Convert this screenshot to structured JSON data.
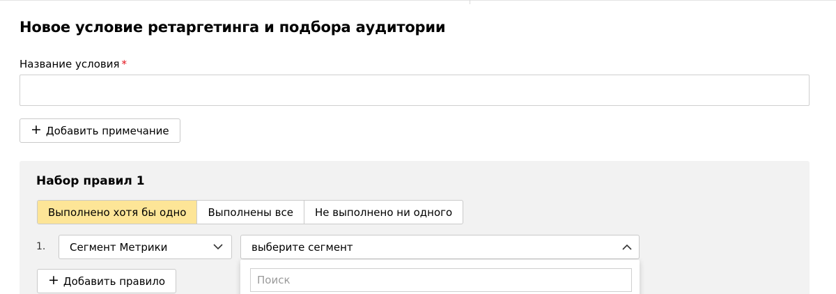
{
  "page": {
    "title": "Новое условие ретаргетинга и подбора аудитории"
  },
  "condition_name": {
    "label": "Название условия",
    "required_mark": "*",
    "value": "",
    "placeholder": ""
  },
  "add_note_button": {
    "icon": "plus-icon",
    "plus": "+",
    "label": "Добавить примечание"
  },
  "ruleset": {
    "title": "Набор правил 1",
    "match_modes": [
      {
        "label": "Выполнено хотя бы одно",
        "selected": true
      },
      {
        "label": "Выполнены все",
        "selected": false
      },
      {
        "label": "Не выполнено ни одного",
        "selected": false
      }
    ],
    "rules": [
      {
        "number": "1.",
        "source_select": {
          "value": "Сегмент Метрики",
          "icon": "chevron-down-icon"
        },
        "segment_select": {
          "value": "выберите сегмент",
          "icon": "chevron-up-icon",
          "expanded": true
        }
      }
    ],
    "add_rule_button": {
      "icon": "plus-icon",
      "plus": "+",
      "label": "Добавить правило"
    }
  },
  "segment_dropdown": {
    "search_placeholder": "Поиск",
    "search_value": ""
  },
  "colors": {
    "active_segment": "#fde597",
    "required_star": "#e3121b",
    "ruleset_background": "#f2f2f2",
    "border": "#c9c9c9"
  }
}
